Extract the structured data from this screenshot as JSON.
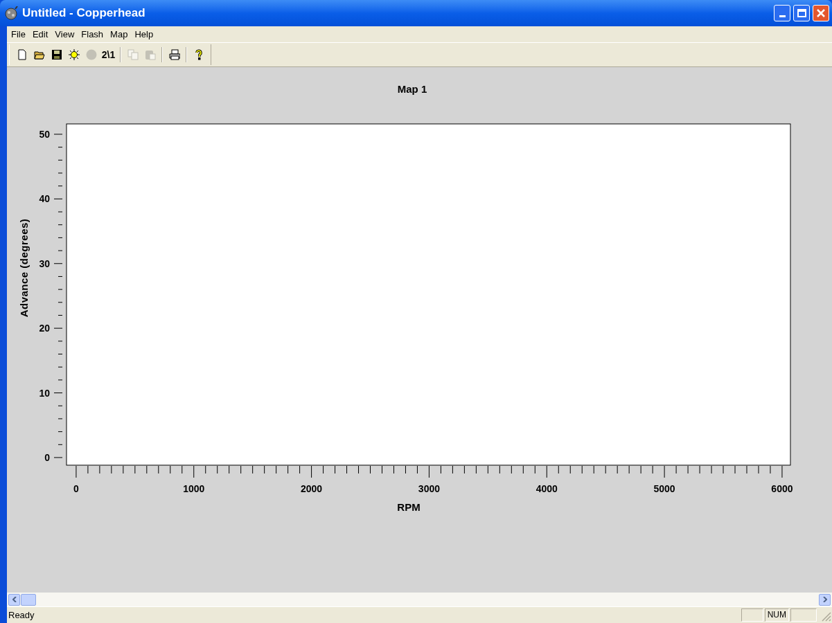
{
  "window": {
    "title": "Untitled - Copperhead"
  },
  "menu": [
    "File",
    "Edit",
    "View",
    "Flash",
    "Map",
    "Help"
  ],
  "toolbar": [
    {
      "kind": "new",
      "disabled": false
    },
    {
      "kind": "open",
      "disabled": false
    },
    {
      "kind": "save",
      "disabled": false
    },
    {
      "kind": "bulb",
      "disabled": false
    },
    {
      "kind": "circle",
      "disabled": true
    },
    {
      "kind": "text",
      "label": "2\\1",
      "disabled": false
    },
    {
      "kind": "separator"
    },
    {
      "kind": "copy",
      "disabled": true
    },
    {
      "kind": "paste",
      "disabled": true
    },
    {
      "kind": "separator"
    },
    {
      "kind": "print",
      "disabled": false
    },
    {
      "kind": "separator"
    },
    {
      "kind": "help",
      "disabled": false
    }
  ],
  "chart": {
    "chart_data": {
      "type": "line",
      "title": "Map 1",
      "xlabel": "RPM",
      "ylabel": "Advance (degrees)",
      "xlim": [
        -82,
        6071
      ],
      "ylim": [
        -1.18,
        51.6
      ],
      "xticks": [
        0,
        1000,
        2000,
        3000,
        4000,
        5000,
        6000
      ],
      "yticks": [
        0,
        10,
        20,
        30,
        40,
        50
      ]
    }
  },
  "status_bar": {
    "text": "Ready",
    "indicators": [
      "NUM"
    ]
  }
}
